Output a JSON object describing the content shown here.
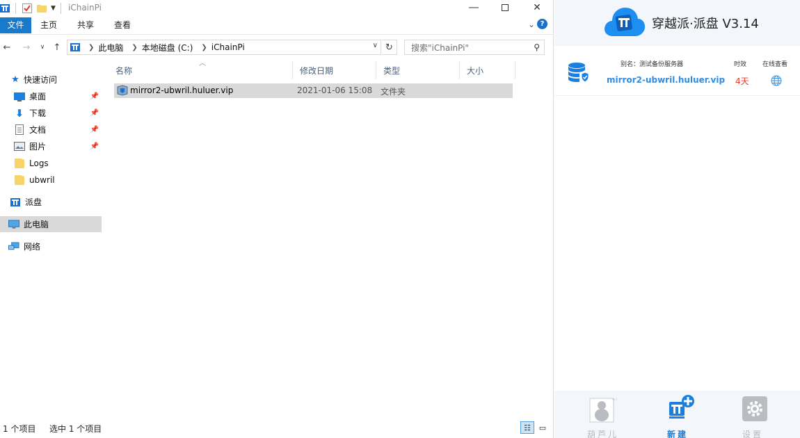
{
  "explorer": {
    "title": "iChainPi",
    "ribbon_tabs": [
      "文件",
      "主页",
      "共享",
      "查看"
    ],
    "address": {
      "breadcrumb": [
        "此电脑",
        "本地磁盘 (C:)",
        "iChainPi"
      ]
    },
    "search": {
      "placeholder": "搜索\"iChainPi\""
    },
    "nav": {
      "quick_access": "快速访问",
      "items": [
        {
          "label": "桌面",
          "pinned": true,
          "icon": "desktop-icon"
        },
        {
          "label": "下载",
          "pinned": true,
          "icon": "download-icon"
        },
        {
          "label": "文档",
          "pinned": true,
          "icon": "document-icon"
        },
        {
          "label": "图片",
          "pinned": true,
          "icon": "picture-icon"
        },
        {
          "label": "Logs",
          "pinned": false,
          "icon": "folder-icon"
        },
        {
          "label": "ubwril",
          "pinned": false,
          "icon": "folder-icon"
        }
      ],
      "paipan": "派盘",
      "this_pc": "此电脑",
      "network": "网络"
    },
    "columns": [
      "名称",
      "修改日期",
      "类型",
      "大小"
    ],
    "files": [
      {
        "name": "mirror2-ubwril.huluer.vip",
        "modified": "2021-01-06 15:08",
        "type": "文件夹",
        "size": ""
      }
    ],
    "status": {
      "count": "1 个项目",
      "selected": "选中 1 个项目"
    }
  },
  "panel": {
    "app_title": "穿越派·派盘 V3.14",
    "server_headers": {
      "alias": "别名：测试备份服务器",
      "validity": "时效",
      "online": "在线查看"
    },
    "server": {
      "name": "mirror2-ubwril.huluer.vip",
      "days": "4天"
    },
    "bottom_nav": {
      "hulu": "葫芦儿",
      "new": "新建",
      "settings": "设置"
    },
    "colors": {
      "accent": "#1a7fe0",
      "days": "#e83a2b",
      "server_name": "#2f8de4"
    }
  }
}
